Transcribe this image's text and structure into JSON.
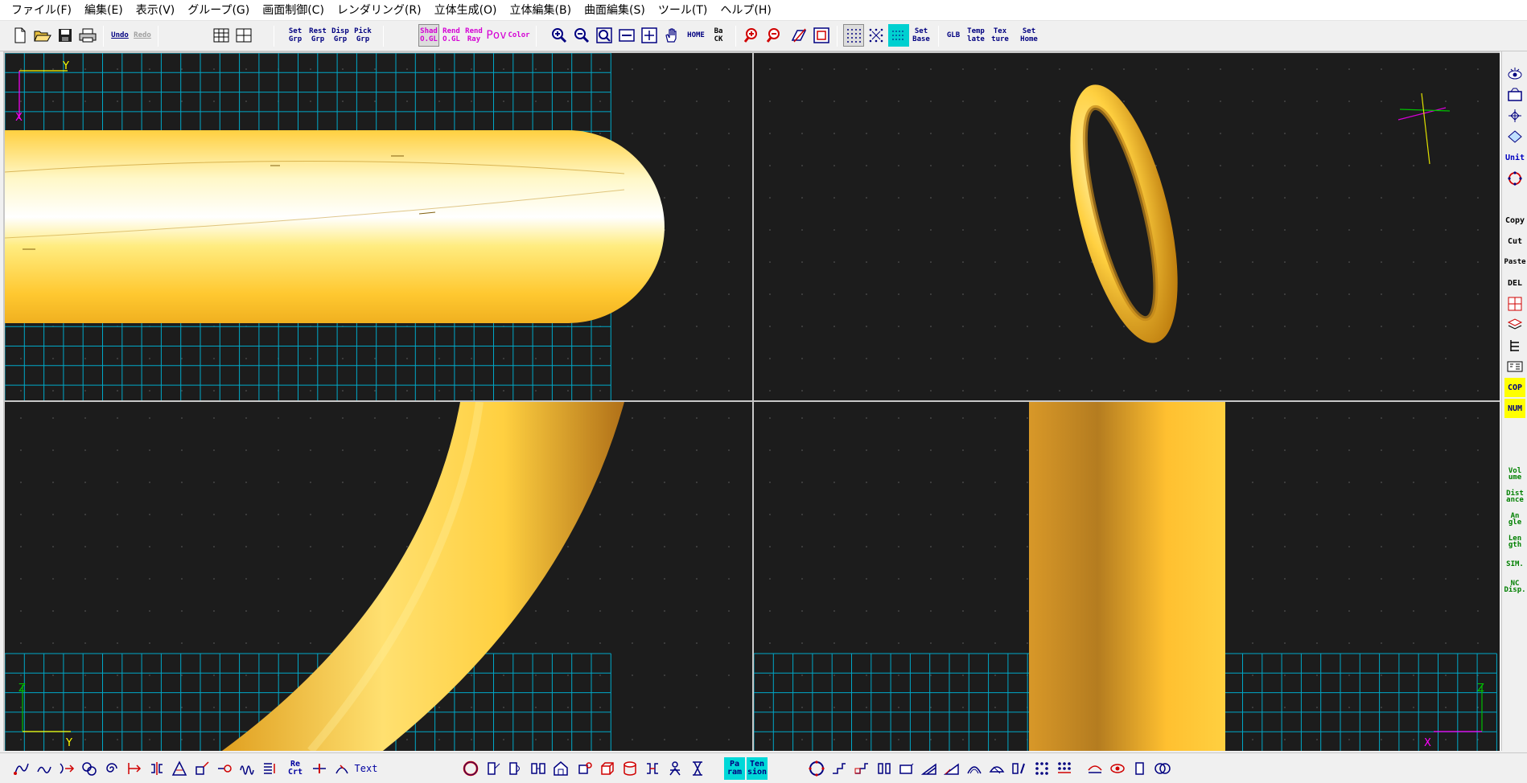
{
  "menu": [
    "ファイル(F)",
    "編集(E)",
    "表示(V)",
    "グループ(G)",
    "画面制御(C)",
    "レンダリング(R)",
    "立体生成(O)",
    "立体編集(B)",
    "曲面編集(S)",
    "ツール(T)",
    "ヘルプ(H)"
  ],
  "toolbar": {
    "undo": "Undo",
    "redo": "Redo",
    "set_grp": [
      "Set",
      "Grp"
    ],
    "rest_grp": [
      "Rest",
      "Grp"
    ],
    "disp_grp": [
      "Disp",
      "Grp"
    ],
    "pick_grp": [
      "Pick",
      "Grp"
    ],
    "shad_ogl": [
      "Shad",
      "O.GL"
    ],
    "rend_ogl": [
      "Rend",
      "O.GL"
    ],
    "rend_ray": [
      "Rend",
      "Ray"
    ],
    "pov": "Pov",
    "color": "Color",
    "home": "HOME",
    "back": [
      "Ba",
      "CK"
    ],
    "set_base": [
      "Set",
      "Base"
    ],
    "glb": "GLB",
    "template": [
      "Temp",
      "late"
    ],
    "texture": [
      "Tex",
      "ture"
    ],
    "set_home": [
      "Set",
      "Home"
    ]
  },
  "right_toolbar": {
    "unit": "Unit",
    "copy": "Copy",
    "cut": "Cut",
    "paste": "Paste",
    "del": "DEL",
    "cop": "COP",
    "num": "NUM",
    "volume": [
      "Vol",
      "ume"
    ],
    "distance": [
      "Dist",
      "ance"
    ],
    "angle": [
      "An",
      "gle"
    ],
    "length": [
      "Len",
      "gth"
    ],
    "sim": "SIM.",
    "nc_disp": [
      "NC",
      "Disp."
    ]
  },
  "bottom_toolbar": {
    "re_crt": [
      "Re",
      "Crt"
    ],
    "text": "Text",
    "param": [
      "Pa",
      "ram"
    ],
    "tension": [
      "Ten",
      "sion"
    ]
  },
  "viewports": {
    "top_left": {
      "axis_h": "Y",
      "axis_v": "X"
    },
    "bottom_left": {
      "axis_h": "Y",
      "axis_v": "Z"
    },
    "bottom_right": {
      "axis_h": "X",
      "axis_v": "Z"
    }
  },
  "colors": {
    "gold_light": "#fffad0",
    "gold_mid": "#ffd84a",
    "gold_dark": "#c88a1c",
    "grid": "#00a8c8",
    "background": "#1c1c1c"
  }
}
